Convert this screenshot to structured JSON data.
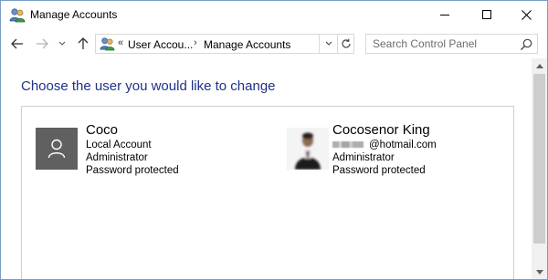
{
  "window": {
    "title": "Manage Accounts",
    "icon": "user-accounts-icon"
  },
  "title_buttons": {
    "minimize": "minimize-icon",
    "maximize": "maximize-icon",
    "close": "close-icon"
  },
  "navigation": {
    "back": "arrow-left-icon",
    "forward": "arrow-right-icon",
    "recent": "chevron-down-icon",
    "up": "arrow-up-icon"
  },
  "address": {
    "overflow": "«",
    "segments": [
      "User Accou...",
      "Manage Accounts"
    ],
    "separator": "›"
  },
  "search": {
    "placeholder": "Search Control Panel",
    "value": ""
  },
  "main": {
    "heading": "Choose the user you would like to change"
  },
  "accounts": [
    {
      "name": "Coco",
      "line1": "Local Account",
      "line2": "Administrator",
      "line3": "Password protected",
      "avatar": "user-silhouette-icon"
    },
    {
      "name": "Cocosenor King",
      "email_suffix": "@hotmail.com",
      "line2": "Administrator",
      "line3": "Password protected",
      "avatar": "user-photo"
    }
  ],
  "colors": {
    "heading": "#1e3287",
    "avatar_bg": "#606060",
    "border": "#cfcfcf",
    "scroll_thumb": "#cdcdcd"
  }
}
